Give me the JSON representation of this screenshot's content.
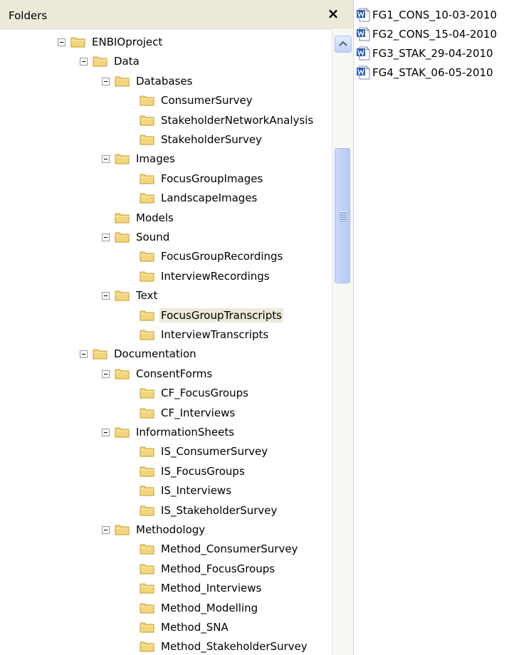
{
  "folders_pane": {
    "title": "Folders",
    "close_label": "×"
  },
  "tree": [
    {
      "label": "ENBIOproject",
      "depth": 0,
      "expanded": true,
      "icon": "folder-icon"
    },
    {
      "label": "Data",
      "depth": 1,
      "expanded": true,
      "icon": "folder-icon"
    },
    {
      "label": "Databases",
      "depth": 2,
      "expanded": true,
      "icon": "folder-icon"
    },
    {
      "label": "ConsumerSurvey",
      "depth": 3,
      "expanded": false,
      "icon": "folder-icon"
    },
    {
      "label": "StakeholderNetworkAnalysis",
      "depth": 3,
      "expanded": false,
      "icon": "folder-icon"
    },
    {
      "label": "StakeholderSurvey",
      "depth": 3,
      "expanded": false,
      "icon": "folder-icon"
    },
    {
      "label": "Images",
      "depth": 2,
      "expanded": true,
      "icon": "folder-icon"
    },
    {
      "label": "FocusGroupImages",
      "depth": 3,
      "expanded": false,
      "icon": "folder-icon"
    },
    {
      "label": "LandscapeImages",
      "depth": 3,
      "expanded": false,
      "icon": "folder-icon"
    },
    {
      "label": "Models",
      "depth": 2,
      "expanded": false,
      "icon": "folder-icon"
    },
    {
      "label": "Sound",
      "depth": 2,
      "expanded": true,
      "icon": "folder-icon"
    },
    {
      "label": "FocusGroupRecordings",
      "depth": 3,
      "expanded": false,
      "icon": "folder-icon"
    },
    {
      "label": "InterviewRecordings",
      "depth": 3,
      "expanded": false,
      "icon": "folder-icon"
    },
    {
      "label": "Text",
      "depth": 2,
      "expanded": true,
      "icon": "folder-icon"
    },
    {
      "label": "FocusGroupTranscripts",
      "depth": 3,
      "expanded": false,
      "icon": "folder-open-icon",
      "selected": true
    },
    {
      "label": "InterviewTranscripts",
      "depth": 3,
      "expanded": false,
      "icon": "folder-icon"
    },
    {
      "label": "Documentation",
      "depth": 1,
      "expanded": true,
      "icon": "folder-icon"
    },
    {
      "label": "ConsentForms",
      "depth": 2,
      "expanded": true,
      "icon": "folder-icon"
    },
    {
      "label": "CF_FocusGroups",
      "depth": 3,
      "expanded": false,
      "icon": "folder-icon"
    },
    {
      "label": "CF_Interviews",
      "depth": 3,
      "expanded": false,
      "icon": "folder-icon"
    },
    {
      "label": "InformationSheets",
      "depth": 2,
      "expanded": true,
      "icon": "folder-icon"
    },
    {
      "label": "IS_ConsumerSurvey",
      "depth": 3,
      "expanded": false,
      "icon": "folder-icon"
    },
    {
      "label": "IS_FocusGroups",
      "depth": 3,
      "expanded": false,
      "icon": "folder-icon"
    },
    {
      "label": "IS_Interviews",
      "depth": 3,
      "expanded": false,
      "icon": "folder-icon"
    },
    {
      "label": "IS_StakeholderSurvey",
      "depth": 3,
      "expanded": false,
      "icon": "folder-icon"
    },
    {
      "label": "Methodology",
      "depth": 2,
      "expanded": true,
      "icon": "folder-icon"
    },
    {
      "label": "Method_ConsumerSurvey",
      "depth": 3,
      "expanded": false,
      "icon": "folder-icon"
    },
    {
      "label": "Method_FocusGroups",
      "depth": 3,
      "expanded": false,
      "icon": "folder-icon"
    },
    {
      "label": "Method_Interviews",
      "depth": 3,
      "expanded": false,
      "icon": "folder-icon"
    },
    {
      "label": "Method_Modelling",
      "depth": 3,
      "expanded": false,
      "icon": "folder-icon"
    },
    {
      "label": "Method_SNA",
      "depth": 3,
      "expanded": false,
      "icon": "folder-icon"
    },
    {
      "label": "Method_StakeholderSurvey",
      "depth": 3,
      "expanded": false,
      "icon": "folder-icon"
    }
  ],
  "files": [
    {
      "name": "FG1_CONS_10-03-2010",
      "icon": "word-document-icon"
    },
    {
      "name": "FG2_CONS_15-04-2010",
      "icon": "word-document-icon"
    },
    {
      "name": "FG3_STAK_29-04-2010",
      "icon": "word-document-icon"
    },
    {
      "name": "FG4_STAK_06-05-2010",
      "icon": "word-document-icon"
    }
  ],
  "colors": {
    "folder_fill": "#f3d57c",
    "folder_stroke": "#c79a2a",
    "selection": "#ece9d8",
    "header_bg": "#ece9d8",
    "scroll_thumb": "#b8cbf7",
    "word_blue": "#2b5db8"
  }
}
